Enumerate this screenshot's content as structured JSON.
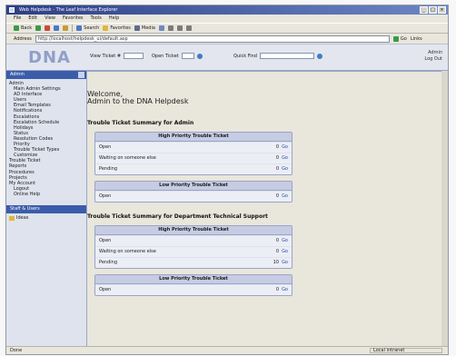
{
  "window": {
    "title": "Web Helpdesk - The Leaf Interface Explorer"
  },
  "menu": [
    "File",
    "Edit",
    "View",
    "Favorites",
    "Tools",
    "Help"
  ],
  "toolbar": {
    "back_label": "Back",
    "search_label": "Search",
    "favorites_label": "Favorites",
    "media_label": "Media"
  },
  "address": {
    "label": "Address",
    "value": "http://localhost/helpdesk_ui/default.asp",
    "go_label": "Go",
    "links_label": "Links"
  },
  "header": {
    "logo": "DNA",
    "view_ticket_label": "View Ticket #",
    "open_ticket_label": "Open Ticket",
    "quick_find_label": "Quick Find",
    "user_line_1": "Admin",
    "user_line_2": "Log Out"
  },
  "nav": {
    "title": "Admin",
    "items": [
      {
        "label": "Admin",
        "top": true
      },
      {
        "label": "Main Admin Settings"
      },
      {
        "label": "AD Interface"
      },
      {
        "label": "Users"
      },
      {
        "label": "Email Templates"
      },
      {
        "label": "Notifications"
      },
      {
        "label": "Escalations"
      },
      {
        "label": "Escalation Schedule"
      },
      {
        "label": "Holidays"
      },
      {
        "label": "Status"
      },
      {
        "label": "Resolution Codes"
      },
      {
        "label": "Priority"
      },
      {
        "label": "Trouble Ticket Types"
      },
      {
        "label": "Customize"
      },
      {
        "label": "Trouble Ticket",
        "top": true
      },
      {
        "label": "Reports",
        "top": true
      },
      {
        "label": "Procedures",
        "top": true
      },
      {
        "label": "Projects",
        "top": true
      },
      {
        "label": "My Account",
        "top": true
      },
      {
        "label": "Logout"
      },
      {
        "label": "Online Help"
      }
    ],
    "section2_title": "Staff & Users",
    "section2_link": "Ideas"
  },
  "main": {
    "welcome_line_1": "Welcome,",
    "welcome_line_2": "Admin to the DNA Helpdesk",
    "section1_title": "Trouble Ticket Summary for Admin",
    "box1_title": "High Priority Trouble Ticket",
    "box1_rows": [
      {
        "label": "Open",
        "count": "0",
        "go": "Go"
      },
      {
        "label": "Waiting on someone else",
        "count": "0",
        "go": "Go"
      },
      {
        "label": "Pending",
        "count": "0",
        "go": "Go"
      }
    ],
    "box2_title": "Low Priority Trouble Ticket",
    "box2_rows": [
      {
        "label": "Open",
        "count": "0",
        "go": "Go"
      }
    ],
    "section2_title": "Trouble Ticket Summary for Department Technical Support",
    "box3_title": "High Priority Trouble Ticket",
    "box3_rows": [
      {
        "label": "Open",
        "count": "0",
        "go": "Go"
      },
      {
        "label": "Waiting on someone else",
        "count": "0",
        "go": "Go"
      },
      {
        "label": "Pending",
        "count": "10",
        "go": "Go"
      }
    ],
    "box4_title": "Low Priority Trouble Ticket",
    "box4_rows": [
      {
        "label": "Open",
        "count": "0",
        "go": "Go"
      }
    ]
  },
  "status": {
    "left": "Done",
    "right": "Local intranet"
  }
}
